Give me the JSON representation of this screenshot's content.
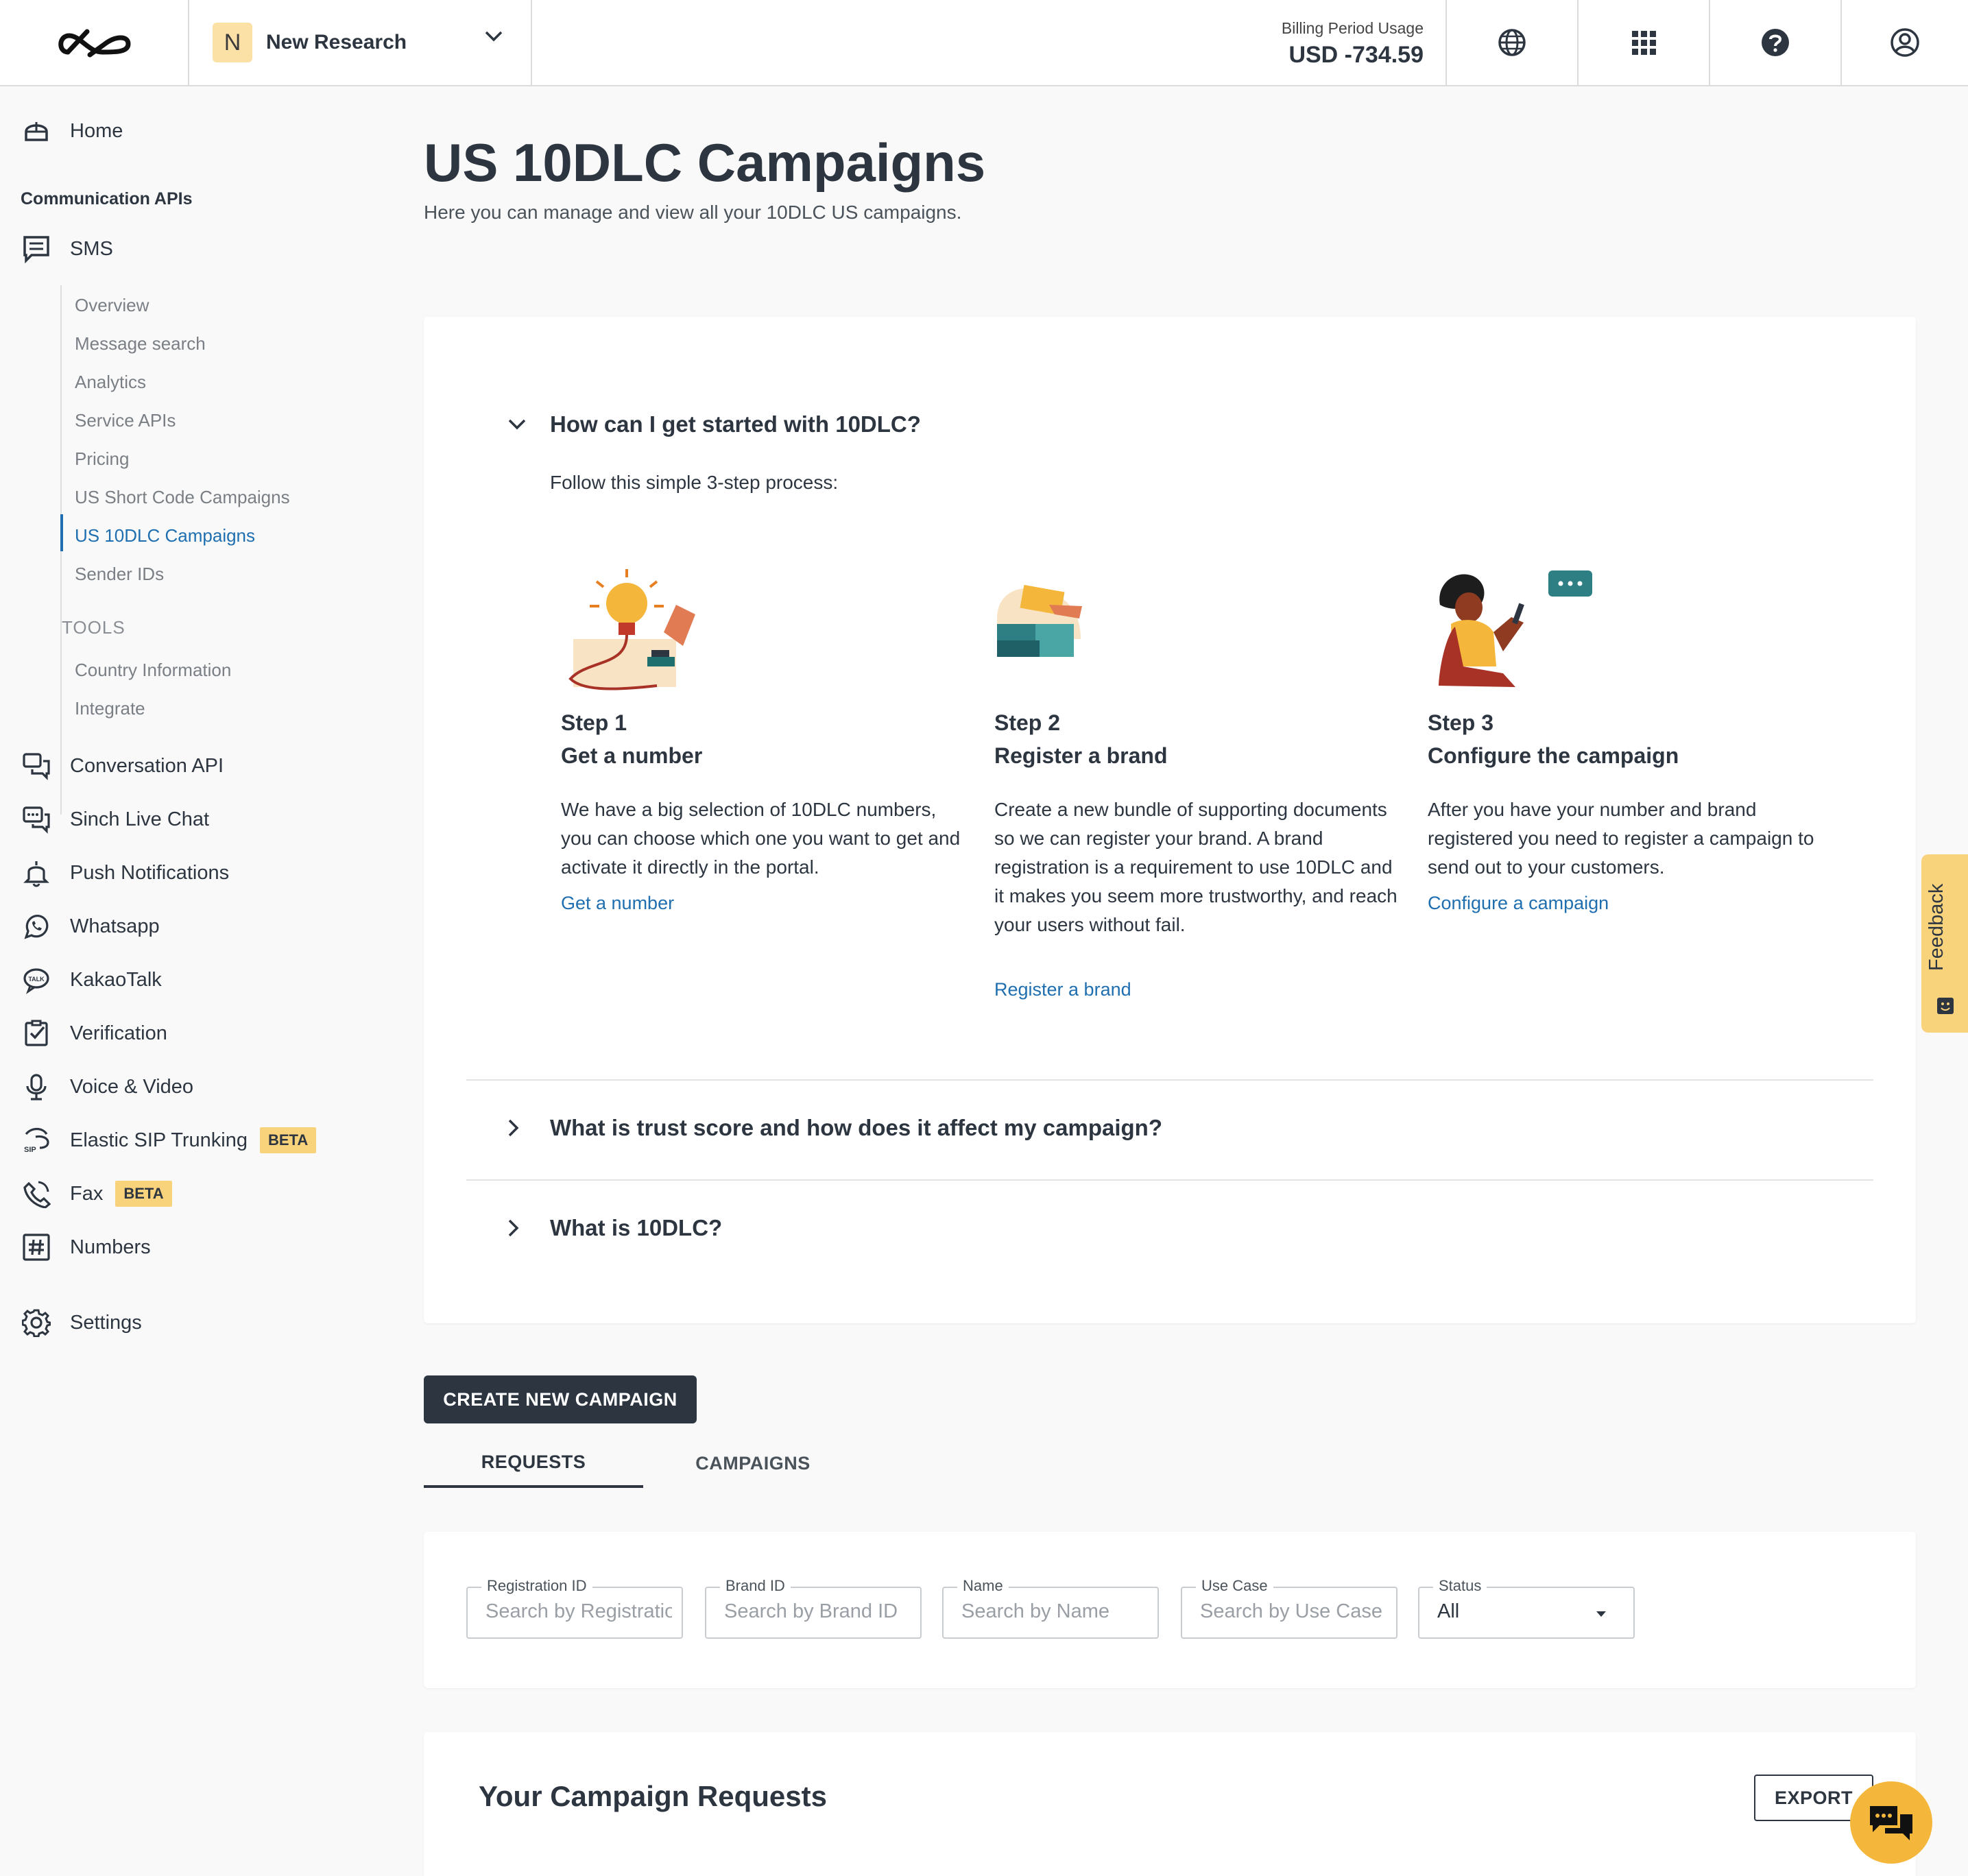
{
  "header": {
    "project_initial": "N",
    "project_name": "New Research",
    "billing_label": "Billing Period Usage",
    "billing_value": "USD -734.59",
    "icons": [
      "globe-icon",
      "apps-grid-icon",
      "help-icon",
      "account-icon"
    ]
  },
  "sidebar": {
    "home": "Home",
    "section_comm": "Communication APIs",
    "sms": "SMS",
    "sms_items": [
      "Overview",
      "Message search",
      "Analytics",
      "Service APIs",
      "Pricing",
      "US Short Code Campaigns",
      "US 10DLC Campaigns",
      "Sender IDs"
    ],
    "active_item": "US 10DLC Campaigns",
    "tools_title": "TOOLS",
    "tools_items": [
      "Country Information",
      "Integrate"
    ],
    "apis": [
      "Conversation API",
      "Sinch Live Chat",
      "Push Notifications",
      "Whatsapp",
      "KakaoTalk",
      "Verification",
      "Voice & Video",
      "Elastic SIP Trunking",
      "Fax",
      "Numbers"
    ],
    "beta_label": "BETA",
    "settings": "Settings"
  },
  "main": {
    "title": "US 10DLC Campaigns",
    "subtitle": "Here you can manage and view all your 10DLC US campaigns.",
    "faq": {
      "q1": "How can I get started with 10DLC?",
      "intro": "Follow this simple 3-step process:",
      "steps": [
        {
          "num": "Step 1",
          "title": "Get a number",
          "desc": "We have a big selection of 10DLC numbers, you can choose which one you want to get and activate it directly in the portal.",
          "link": "Get a number"
        },
        {
          "num": "Step 2",
          "title": "Register a brand",
          "desc": "Create a new bundle of supporting documents so we can register your brand. A brand registration is a requirement to use 10DLC and it makes you seem more trustworthy, and reach your users without fail.",
          "link": "Register a brand"
        },
        {
          "num": "Step 3",
          "title": "Configure the campaign",
          "desc": "After you have your number and brand registered you need to register a campaign to send out to your customers.",
          "link": "Configure a campaign"
        }
      ],
      "q2": "What is trust score and how does it affect my campaign?",
      "q3": "What is 10DLC?"
    },
    "create_button": "CREATE NEW CAMPAIGN",
    "tabs": [
      "REQUESTS",
      "CAMPAIGNS"
    ],
    "active_tab": "REQUESTS",
    "filters": [
      {
        "label": "Registration ID",
        "placeholder": "Search by Registration ID"
      },
      {
        "label": "Brand ID",
        "placeholder": "Search by Brand ID"
      },
      {
        "label": "Name",
        "placeholder": "Search by Name"
      },
      {
        "label": "Use Case",
        "placeholder": "Search by Use Case"
      }
    ],
    "status_filter": {
      "label": "Status",
      "value": "All"
    },
    "requests_title": "Your Campaign Requests",
    "export_button": "EXPORT"
  },
  "feedback_label": "Feedback",
  "colors": {
    "accent_link": "#1f6fb0",
    "primary_dark": "#2d3640",
    "beta_badge": "#f9d27c",
    "chat_bubble": "#f5b63c"
  }
}
